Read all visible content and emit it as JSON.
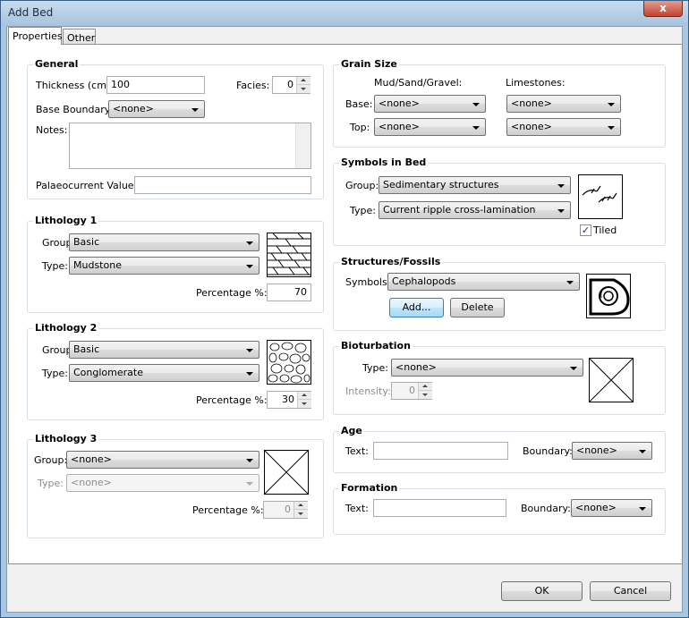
{
  "window": {
    "title": "Add Bed",
    "close_glyph": "x"
  },
  "tabs": [
    {
      "label": "Properties"
    },
    {
      "label": "Other"
    }
  ],
  "general": {
    "title": "General",
    "thickness_label": "Thickness (cm):",
    "thickness_value": "100",
    "facies_label": "Facies:",
    "facies_value": "0",
    "base_boundary_label": "Base Boundary:",
    "base_boundary_value": "<none>",
    "notes_label": "Notes:",
    "palaeocurrent_label": "Palaeocurrent Values:"
  },
  "lithology1": {
    "title": "Lithology 1",
    "group_label": "Group:",
    "group_value": "Basic",
    "type_label": "Type:",
    "type_value": "Mudstone",
    "percentage_label": "Percentage %:",
    "percentage_value": "70"
  },
  "lithology2": {
    "title": "Lithology 2",
    "group_label": "Group:",
    "group_value": "Basic",
    "type_label": "Type:",
    "type_value": "Conglomerate",
    "percentage_label": "Percentage %:",
    "percentage_value": "30"
  },
  "lithology3": {
    "title": "Lithology 3",
    "group_label": "Group:",
    "group_value": "<none>",
    "type_label": "Type:",
    "type_value": "<none>",
    "percentage_label": "Percentage %:",
    "percentage_value": "0"
  },
  "grain_size": {
    "title": "Grain Size",
    "mud_header": "Mud/Sand/Gravel:",
    "lime_header": "Limestones:",
    "base_label": "Base:",
    "top_label": "Top:",
    "base_mud": "<none>",
    "base_lime": "<none>",
    "top_mud": "<none>",
    "top_lime": "<none>"
  },
  "symbols": {
    "title": "Symbols in Bed",
    "group_label": "Group:",
    "group_value": "Sedimentary structures",
    "type_label": "Type:",
    "type_value": "Current ripple cross-lamination",
    "tiled_label": "Tiled",
    "tiled_checked": "✓"
  },
  "structures": {
    "title": "Structures/Fossils",
    "symbols_label": "Symbols:",
    "symbols_value": "Cephalopods",
    "add_label": "Add...",
    "delete_label": "Delete"
  },
  "bioturbation": {
    "title": "Bioturbation",
    "type_label": "Type:",
    "type_value": "<none>",
    "intensity_label": "Intensity:",
    "intensity_value": "0"
  },
  "age": {
    "title": "Age",
    "text_label": "Text:",
    "boundary_label": "Boundary:",
    "boundary_value": "<none>"
  },
  "formation": {
    "title": "Formation",
    "text_label": "Text:",
    "boundary_label": "Boundary:",
    "boundary_value": "<none>"
  },
  "footer": {
    "ok_label": "OK",
    "cancel_label": "Cancel"
  }
}
